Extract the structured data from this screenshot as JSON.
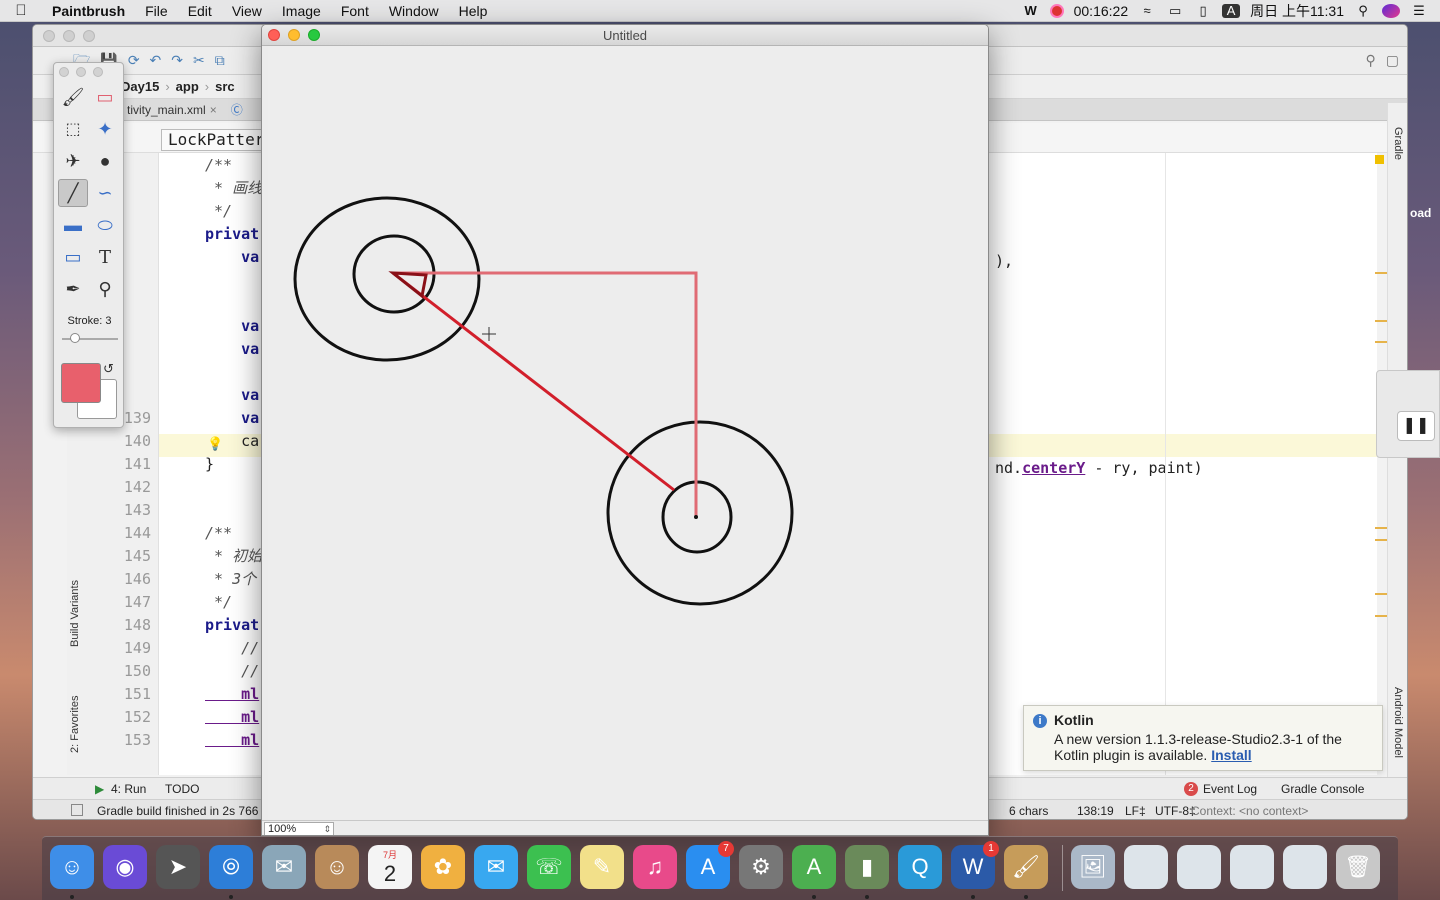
{
  "menubar": {
    "app_name": "Paintbrush",
    "items": [
      "File",
      "Edit",
      "View",
      "Image",
      "Font",
      "Window",
      "Help"
    ],
    "clock_record": "00:16:22",
    "datetime": "周日 上午11:31",
    "input_method": "A"
  },
  "ide": {
    "breadcrumb": [
      "Day15",
      "app",
      "src"
    ],
    "tab_file": "tivity_main.xml",
    "class_label": "LockPatter",
    "code_lines": [
      {
        "num": "",
        "code": "/**",
        "style": "cm"
      },
      {
        "num": "",
        "code": " * 画线",
        "style": "cm"
      },
      {
        "num": "",
        "code": " */",
        "style": "cm"
      },
      {
        "num": "",
        "code": "privat",
        "style": "kw"
      },
      {
        "num": "",
        "code": "    va",
        "style": "kw"
      },
      {
        "num": "",
        "code": "",
        "style": ""
      },
      {
        "num": "",
        "code": "",
        "style": ""
      },
      {
        "num": "",
        "code": "    va",
        "style": "kw"
      },
      {
        "num": "",
        "code": "    va",
        "style": "kw"
      },
      {
        "num": "",
        "code": "",
        "style": ""
      },
      {
        "num": "",
        "code": "    va",
        "style": "kw"
      },
      {
        "num": "139",
        "code": "    va",
        "style": "kw"
      },
      {
        "num": "140",
        "code": "    ca",
        "style": ""
      },
      {
        "num": "141",
        "code": "}",
        "style": ""
      },
      {
        "num": "142",
        "code": "",
        "style": ""
      },
      {
        "num": "143",
        "code": "",
        "style": ""
      },
      {
        "num": "144",
        "code": "/**",
        "style": "cm"
      },
      {
        "num": "145",
        "code": " * 初始",
        "style": "cm"
      },
      {
        "num": "146",
        "code": " * 3个",
        "style": "cm"
      },
      {
        "num": "147",
        "code": " */",
        "style": "cm"
      },
      {
        "num": "148",
        "code": "privat",
        "style": "kw"
      },
      {
        "num": "149",
        "code": "    //",
        "style": "cm"
      },
      {
        "num": "150",
        "code": "    //",
        "style": "cm"
      },
      {
        "num": "151",
        "code": "    ml",
        "style": "pu"
      },
      {
        "num": "152",
        "code": "    ml",
        "style": "pu"
      },
      {
        "num": "153",
        "code": "    ml",
        "style": "pu"
      }
    ],
    "code_right_1": "),",
    "code_right_2_pre": "nd.",
    "code_right_2_link": "centerY",
    "code_right_2_post": " - ry, paint)",
    "left_tool_build_variants": "Build Variants",
    "left_tool_favorites": "2: Favorites",
    "right_tool_gradle": "Gradle",
    "right_tool_android_model": "Android Model",
    "bottom_tools": {
      "run": "4: Run",
      "todo": "TODO",
      "event_log": "Event Log",
      "gradle_console": "Gradle Console",
      "event_count": "2"
    },
    "status": {
      "message": "Gradle build finished in 2s 766",
      "chars": "6 chars",
      "position": "138:19",
      "line_sep": "LF‡",
      "encoding": "UTF-8‡",
      "context": "Context: <no context>"
    },
    "kotlin_popup": {
      "title": "Kotlin",
      "message_line1": "A new version 1.1.3-release-Studio2.3-1 of the",
      "message_line2": "Kotlin plugin is available.",
      "link": "Install"
    },
    "desktop_label": "oad"
  },
  "palette": {
    "stroke_label": "Stroke: 3",
    "stroke_value": 3,
    "foreground_color": "#e8606c",
    "background_color": "#ffffff",
    "tools": [
      "paintbrush-icon",
      "eraser-icon",
      "rect-select-icon",
      "magic-wand-icon",
      "fill-bucket-icon",
      "bomb-icon",
      "line-icon",
      "curve-icon",
      "rectangle-icon",
      "ellipse-icon",
      "rounded-rect-icon",
      "text-icon",
      "eyedropper-icon",
      "zoom-icon"
    ],
    "selected_tool": "line-icon"
  },
  "paint": {
    "window_title": "Untitled",
    "zoom_value": "100%",
    "stroke_color_light": "#e06b74",
    "stroke_color_dark": "#d21f2b",
    "circle_color": "#111111"
  },
  "dock": {
    "apps": [
      "finder-icon",
      "siri-icon",
      "launchpad-icon",
      "safari-icon",
      "mail-icon",
      "contacts-icon",
      "calendar-icon",
      "photos-icon",
      "messages-icon",
      "facetime-icon",
      "notes-icon",
      "itunes-icon",
      "app-store-icon",
      "system-preferences-icon",
      "android-studio-icon",
      "java-icon",
      "quicktime-icon",
      "word-icon",
      "paintbrush-icon",
      "preview-icon",
      "window-thumb-1-icon",
      "window-thumb-2-icon",
      "window-thumb-3-icon",
      "window-thumb-4-icon",
      "trash-icon"
    ],
    "calendar_day": "2",
    "calendar_month": "7月",
    "app_store_badge": "7",
    "word_badge": "1"
  }
}
